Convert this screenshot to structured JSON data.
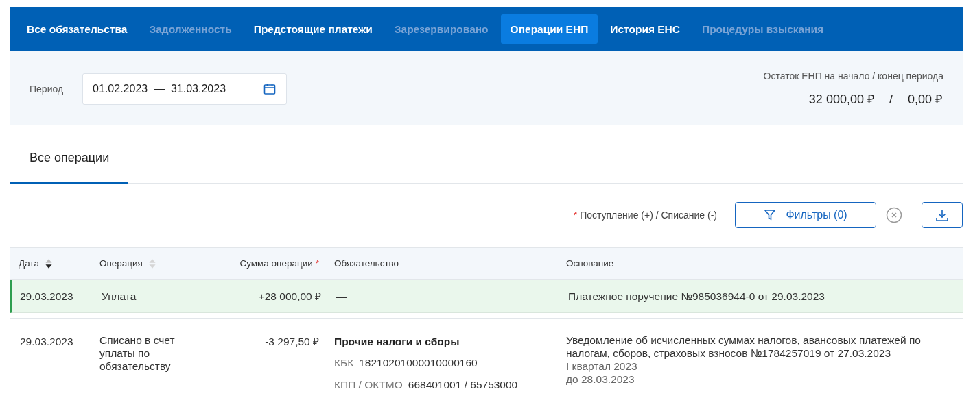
{
  "tabs": [
    {
      "label": "Все обязательства",
      "selected": false,
      "disabled": false
    },
    {
      "label": "Задолженность",
      "selected": false,
      "disabled": true
    },
    {
      "label": "Предстоящие платежи",
      "selected": false,
      "disabled": false
    },
    {
      "label": "Зарезервировано",
      "selected": false,
      "disabled": true
    },
    {
      "label": "Операции ЕНП",
      "selected": true,
      "disabled": false
    },
    {
      "label": "История ЕНС",
      "selected": false,
      "disabled": false
    },
    {
      "label": "Процедуры взыскания",
      "selected": false,
      "disabled": true
    }
  ],
  "period": {
    "label": "Период",
    "from": "01.02.2023",
    "separator": "—",
    "to": "31.03.2023"
  },
  "balance": {
    "label": "Остаток ЕНП на начало / конец периода",
    "start": "32 000,00 ₽",
    "separator": "/",
    "end": "0,00 ₽"
  },
  "subtabs": [
    {
      "label": "Все операции",
      "selected": true
    }
  ],
  "toolbar": {
    "legend_mark": "*",
    "legend": "Поступление (+) / Списание (-)",
    "filters_button": "Фильтры (0)"
  },
  "table": {
    "columns": [
      {
        "label": "Дата",
        "sortable": true,
        "sorted": true
      },
      {
        "label": "Операция",
        "sortable": true,
        "sorted": false
      },
      {
        "label": "Сумма операции",
        "mark": "*"
      },
      {
        "label": "Обязательство"
      },
      {
        "label": "Основание"
      }
    ],
    "rows": [
      {
        "highlighted": true,
        "date": "29.03.2023",
        "operation": "Уплата",
        "amount": "+28 000,00 ₽",
        "obligation": {
          "title": "—"
        },
        "basis": {
          "text": "Платежное поручение №985036944-0 от 29.03.2023"
        }
      },
      {
        "highlighted": false,
        "date": "29.03.2023",
        "operation": "Списано в счет уплаты по обязательству",
        "amount": "-3 297,50 ₽",
        "obligation": {
          "title": "Прочие налоги и сборы",
          "details": [
            {
              "label": "КБК",
              "value": "18210201000010000160"
            },
            {
              "label": "КПП / ОКТМО",
              "value": "668401001 / 65753000"
            }
          ]
        },
        "basis": {
          "text": "Уведомление об исчисленных суммах налогов, авансовых платежей по налогам, сборов, страховых взносов №1784257019 от 27.03.2023",
          "notes": [
            "I квартал 2023",
            "до 28.03.2023"
          ]
        }
      }
    ]
  }
}
